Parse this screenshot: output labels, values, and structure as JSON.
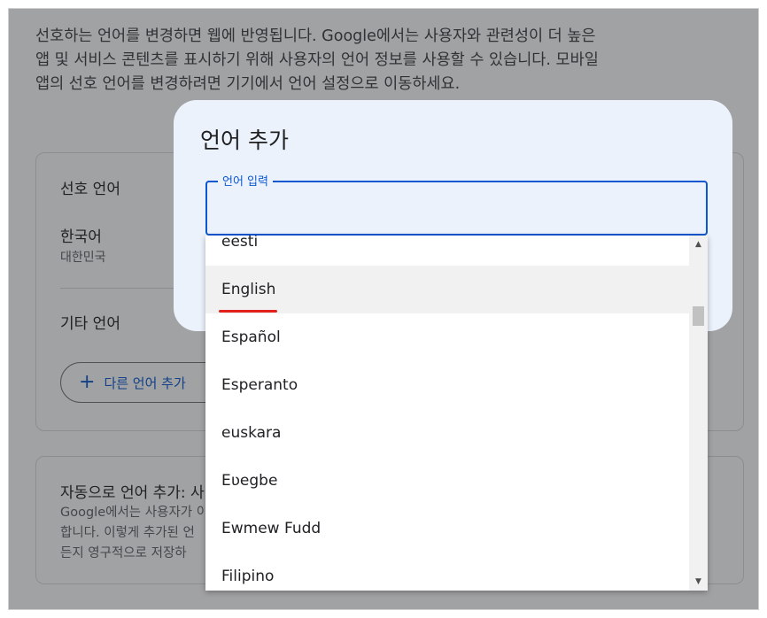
{
  "intro_text": "선호하는 언어를 변경하면 웹에 반영됩니다. Google에서는 사용자와 관련성이 더 높은 앱 및 서비스 콘텐츠를 표시하기 위해 사용자의 언어 정보를 사용할 수 있습니다. 모바일 앱의 선호 언어를 변경하려면 기기에서 언어 설정으로 이동하세요.",
  "preferred": {
    "title": "선호 언어",
    "language": "한국어",
    "region": "대한민국"
  },
  "other": {
    "title": "기타 언어",
    "add_button": "다른 언어 추가"
  },
  "auto": {
    "title": "자동으로 언어 추가: 사",
    "desc_line1": "Google에서는 사용자가 이",
    "desc_line2": "합니다. 이렇게 추가된 언",
    "desc_line3": "든지 영구적으로 저장하"
  },
  "dialog": {
    "title": "언어 추가",
    "field_label": "언어 입력",
    "field_value": ""
  },
  "dropdown": {
    "items": [
      "eesti",
      "English",
      "Español",
      "Esperanto",
      "euskara",
      "Eʋegbe",
      "Ewmew Fudd",
      "Filipino"
    ],
    "highlighted_index": 1
  }
}
